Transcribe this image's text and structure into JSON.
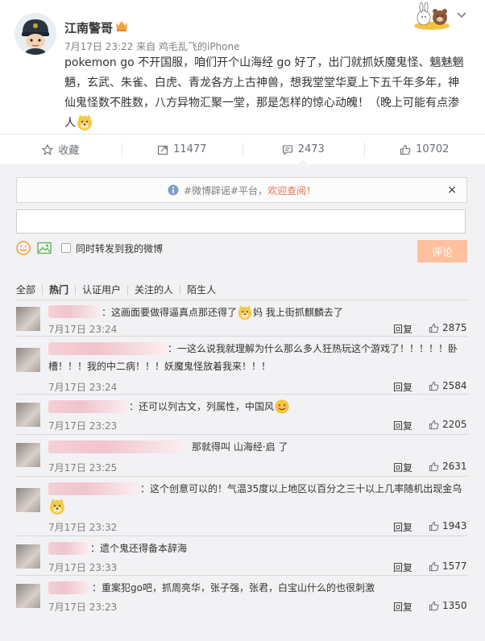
{
  "post": {
    "author": "江南警哥",
    "time": "7月17日 23:22",
    "source_prefix": "来自",
    "source": "鸡毛乱飞的iPhone",
    "text": "pokemon go 不开国服，咱们开个山海经 go 好了，出门就抓妖魔鬼怪、魑魅魍魉，玄武、朱雀、白虎、青龙各方上古神兽，想我堂堂华夏上下五千年多年，神仙鬼怪数不胜数，八方异物汇聚一堂，那是怎样的惊心动魄！（晚上可能有点渗人",
    "emoji": "doge-emoji"
  },
  "actions": [
    {
      "icon": "star-icon",
      "label": "收藏"
    },
    {
      "icon": "repost-icon",
      "label": "11477"
    },
    {
      "icon": "comment-icon",
      "label": "2473"
    },
    {
      "icon": "like-icon",
      "label": "10702"
    }
  ],
  "notice": {
    "tag": "#微博辟谣#平台",
    "sep": "，",
    "link": "欢迎查阅！",
    "close": "×"
  },
  "composer": {
    "repost_label": "同时转发到我的微博",
    "submit": "评论"
  },
  "tabs": [
    "全部",
    "热门",
    "认证用户",
    "关注的人",
    "陌生人"
  ],
  "comments": [
    {
      "text": "：这画面要做得逼真点那还得了",
      "text2": "妈 我上街抓麒麟去了",
      "time": "7月17日 23:24",
      "likes": "2875",
      "reply": "回复"
    },
    {
      "text": "：一这么说我就理解为什么那么多人狂热玩这个游戏了！！！！！卧槽！！！我的中二病！！！妖魔鬼怪放着我来！！！",
      "time": "7月17日 23:24",
      "likes": "2584",
      "reply": "回复"
    },
    {
      "text": "：还可以列古文，列属性，中国风",
      "time": "7月17日 23:23",
      "likes": "2205",
      "reply": "回复"
    },
    {
      "text": "那就得叫  山海经·启  了",
      "time": "7月17日 23:25",
      "likes": "2631",
      "reply": "回复"
    },
    {
      "text": "：这个创意可以的！气温35度以上地区以百分之三十以上几率随机出现金乌",
      "time": "7月17日 23:32",
      "likes": "1943",
      "reply": "回复"
    },
    {
      "text": "：遗个鬼还得备本辞海",
      "time": "7月17日 23:33",
      "likes": "1577",
      "reply": "回复"
    },
    {
      "text": "：重案犯go吧，抓周亮华，张子强，张君，白宝山什么的也很刺激",
      "time": "7月17日 23:23",
      "likes": "1350",
      "reply": "回复"
    }
  ],
  "colors": {
    "accent": "#eb7350",
    "submit_disabled": "#ffc09f",
    "panel_bg": "#f2f2f5"
  }
}
